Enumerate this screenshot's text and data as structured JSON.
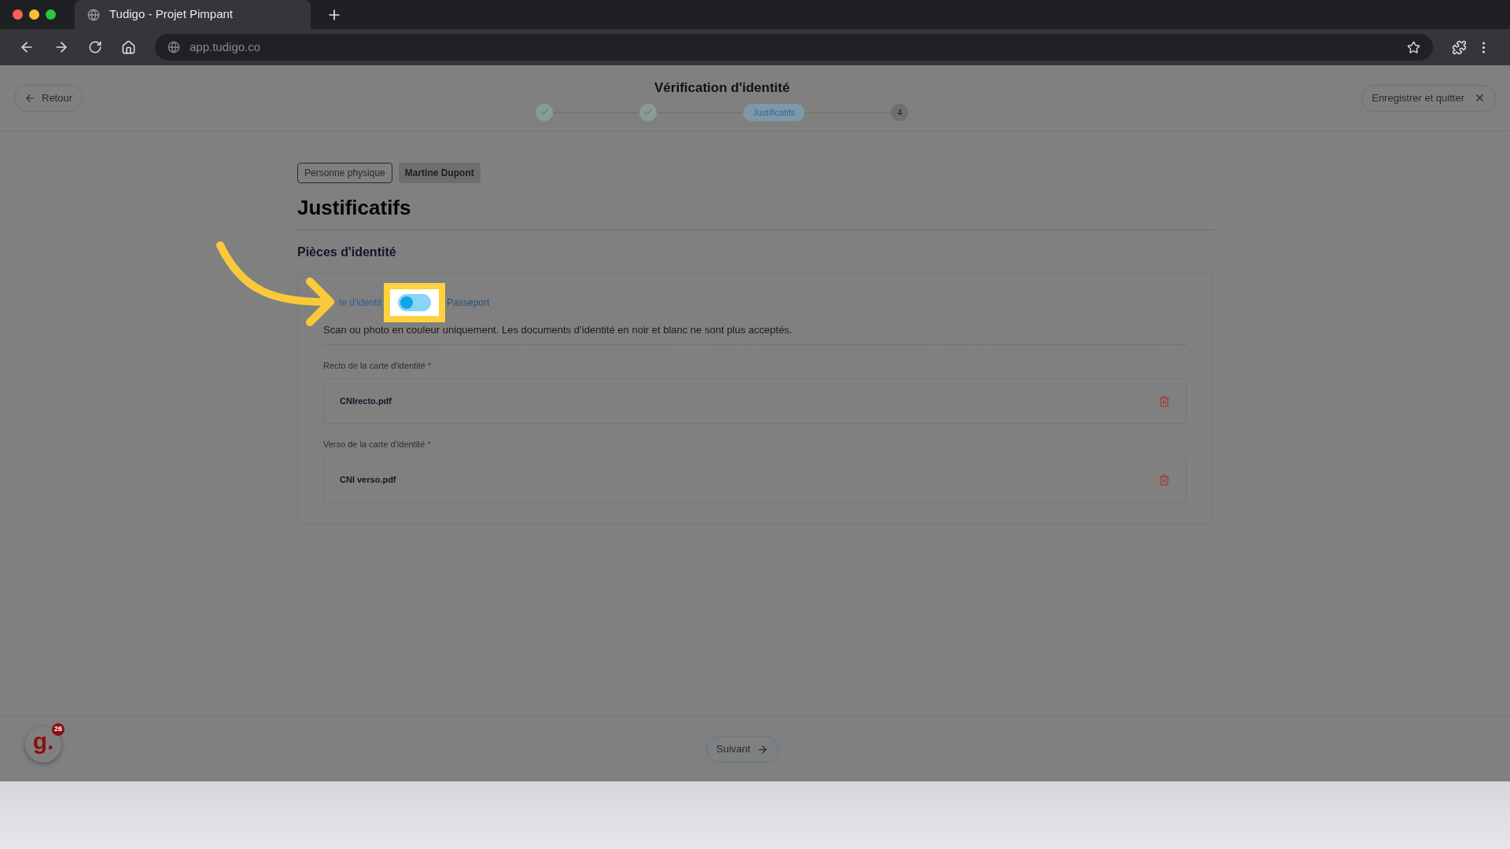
{
  "browser": {
    "tab_title": "Tudigo - Projet Pimpant",
    "url": "app.tudigo.co"
  },
  "header": {
    "back_button": "Retour",
    "title": "Vérification d'identité",
    "save_button": "Enregistrer et quitter",
    "steps": [
      {
        "kind": "done"
      },
      {
        "kind": "done"
      },
      {
        "kind": "current",
        "label": "Justificatifs"
      },
      {
        "kind": "todo",
        "label": "4"
      }
    ]
  },
  "tags": [
    {
      "label": "Personne physique",
      "kind": "outline"
    },
    {
      "label": "Martine Dupont",
      "kind": "filled"
    }
  ],
  "heading": "Justificatifs",
  "section_title": "Pièces d'identité",
  "identity_type": {
    "options": [
      {
        "label": "te d'identit",
        "selected": true
      },
      {
        "label": "Passeport",
        "selected": false
      }
    ],
    "highlighted": true
  },
  "notice": "Scan ou photo en couleur uniquement. Les documents d’identité en noir et blanc ne sont plus acceptés.",
  "files": [
    {
      "label": "Recto de la carte d'identité",
      "required_mark": "*",
      "file": "CNIrecto.pdf"
    },
    {
      "label": "Verso de la carte d'identité",
      "required_mark": "*",
      "file": "CNI verso.pdf"
    }
  ],
  "footer": {
    "next_button": "Suivant",
    "logo": "g.",
    "badge": "26"
  }
}
